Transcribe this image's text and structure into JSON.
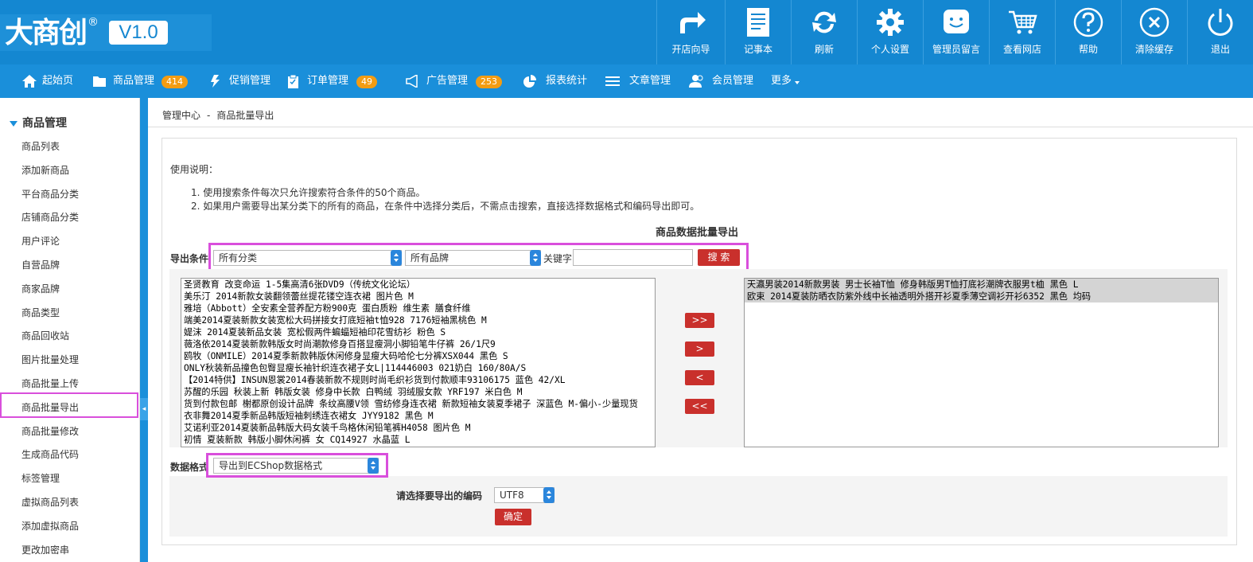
{
  "brand": {
    "logo_text": "大商创",
    "reg_mark": "®",
    "version": "V1.0"
  },
  "toolbar": [
    {
      "label": "开店向导",
      "icon": "share-arrow-icon"
    },
    {
      "label": "记事本",
      "icon": "notepad-icon"
    },
    {
      "label": "刷新",
      "icon": "refresh-icon"
    },
    {
      "label": "个人设置",
      "icon": "gear-icon"
    },
    {
      "label": "管理员留言",
      "icon": "smiley-chat-icon"
    },
    {
      "label": "查看网店",
      "icon": "cart-icon"
    },
    {
      "label": "帮助",
      "icon": "help-icon"
    },
    {
      "label": "清除缓存",
      "icon": "clear-cache-icon"
    },
    {
      "label": "退出",
      "icon": "power-icon"
    }
  ],
  "nav": [
    {
      "label": "起始页",
      "icon": "home-icon"
    },
    {
      "label": "商品管理",
      "icon": "folder-icon",
      "badge": "414"
    },
    {
      "label": "促销管理",
      "icon": "lightning-icon"
    },
    {
      "label": "订单管理",
      "icon": "clipboard-icon",
      "badge": "49"
    },
    {
      "label": "广告管理",
      "icon": "megaphone-icon",
      "badge": "253"
    },
    {
      "label": "报表统计",
      "icon": "pie-chart-icon"
    },
    {
      "label": "文章管理",
      "icon": "list-icon"
    },
    {
      "label": "会员管理",
      "icon": "users-icon"
    },
    {
      "label": "更多",
      "icon": "caret-down-icon"
    }
  ],
  "sidebar": {
    "title": "商品管理",
    "items": [
      "商品列表",
      "添加新商品",
      "平台商品分类",
      "店铺商品分类",
      "用户评论",
      "自营品牌",
      "商家品牌",
      "商品类型",
      "商品回收站",
      "图片批量处理",
      "商品批量上传",
      "商品批量导出",
      "商品批量修改",
      "生成商品代码",
      "标签管理",
      "虚拟商品列表",
      "添加虚拟商品",
      "更改加密串"
    ],
    "active_index": 11
  },
  "breadcrumb": {
    "root": "管理中心",
    "sep": "-",
    "current": "商品批量导出"
  },
  "instructions": {
    "title": "使用说明：",
    "lines": [
      "1. 使用搜索条件每次只允许搜索符合条件的50个商品。",
      "2. 如果用户需要导出某分类下的所有的商品，在条件中选择分类后，不需点击搜索，直接选择数据格式和编码导出即可。"
    ]
  },
  "export": {
    "heading": "商品数据批量导出",
    "cond_label": "导出条件",
    "category_select": "所有分类",
    "brand_select": "所有品牌",
    "keyword_label": "关键字",
    "keyword_value": "",
    "search_button": "搜 索",
    "left_list": [
      "圣贤教育 改变命运 1-5集高清6张DVD9（传统文化论坛）",
      "美乐汀 2014新款女装翻领蕾丝提花镂空连衣裙 图片色 M",
      "雅培（Abbott）全安素全营养配方粉900克 蛋白质粉 维生素 膳食纤维",
      "端美2014夏装新款女装宽松大码拼接女打底短袖t恤928 7176短袖黑桃色 M",
      "媞沫 2014夏装新品女装 宽松假两件蝙蝠短袖印花雪纺衫 粉色 S",
      "薇洛依2014夏装新款韩版女时尚潮款修身百搭显瘦洞小脚铅笔牛仔裤 26/1尺9",
      "鸥牧（ONMILE）2014夏季新款韩版休闲修身显瘦大码哈伦七分裤XSX044 黑色 S",
      "ONLY秋装新品撞色包臀显瘦长袖针织连衣裙子女L|114446003 021奶白 160/80A/S",
      "【2014特供】INSUN恩裳2014春装新款不规则时尚毛织衫货到付款顺丰93106175 蓝色 42/XL",
      "苏醒的乐园 秋装上新 韩版女装 修身中长款 白鸭绒 羽绒服女款 YRF197 米白色 M",
      "货到付款包邮 榭都原创设计品牌 条纹高腰V领 雪纺修身连衣裙 新款短袖女装夏季裙子 深蓝色 M-偏小-少量现货",
      "衣非舞2014夏季新品韩版短袖刺绣连衣裙女 JYY9182 黑色 M",
      "艾诺利亚2014夏装新品韩版大码女装千鸟格休闲铅笔裤H4058 图片色 M",
      "初情 夏装新款 韩版小脚休闲裤 女 CQ14927 水晶蓝 L"
    ],
    "right_list": [
      "天瀛男装2014新款男装 男士长袖T恤 修身韩版男T恤打底衫潮牌衣服男t桖 黑色 L",
      "欧束 2014夏装防晒衣防紫外线中长袖透明外搭开衫夏季薄空调衫开衫6352 黑色 均码"
    ],
    "move_buttons": [
      ">>",
      ">",
      "<",
      "<<"
    ],
    "format_label": "数据格式",
    "format_select": "导出到ECShop数据格式",
    "encoding_label": "请选择要导出的编码",
    "encoding_select": "UTF8",
    "confirm_button": "确定"
  }
}
